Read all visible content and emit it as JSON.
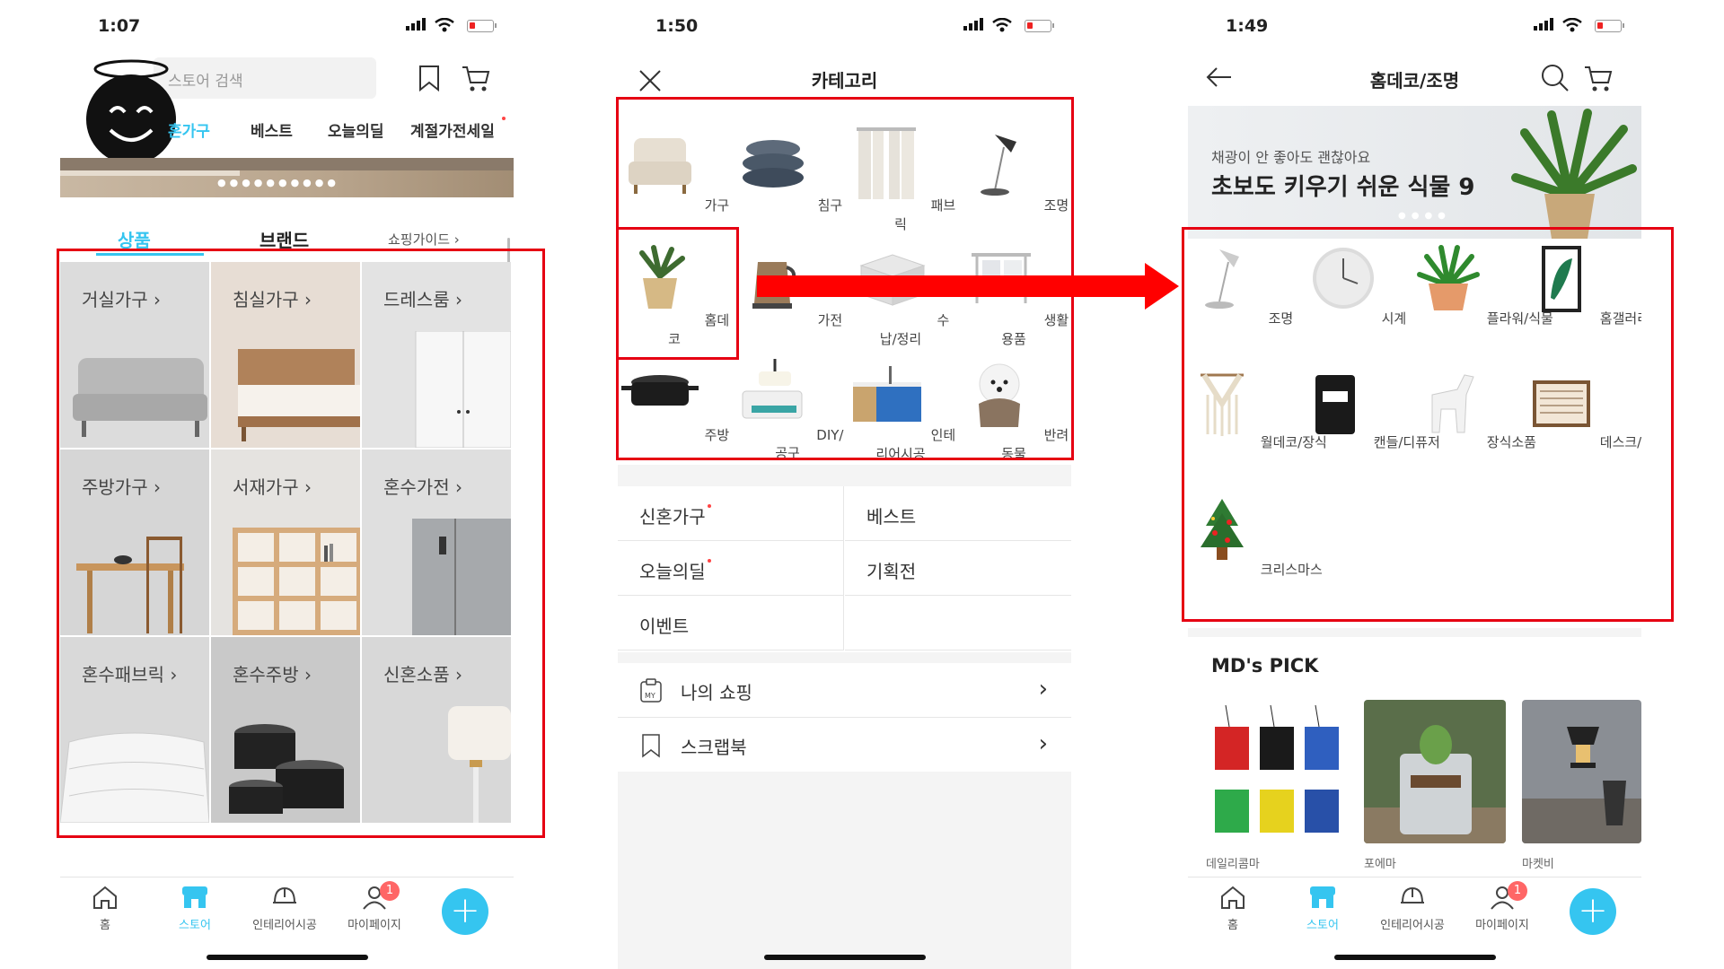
{
  "screen1": {
    "time": "1:07",
    "search_placeholder": "스토어 검색",
    "tabs": [
      "혼가구",
      "베스트",
      "오늘의딜",
      "계절가전세일"
    ],
    "segments": [
      "상품",
      "브랜드"
    ],
    "guide": "쇼핑가이드 ›",
    "categories": [
      "거실가구 ›",
      "침실가구 ›",
      "드레스룸 ›",
      "주방가구 ›",
      "서재가구 ›",
      "혼수가전 ›",
      "혼수패브릭 ›",
      "혼수주방 ›",
      "신혼소품 ›"
    ]
  },
  "screen2": {
    "time": "1:50",
    "title": "카테고리",
    "categories": [
      "가구",
      "침구",
      "패브릭",
      "조명",
      "홈데코",
      "가전",
      "수납/정리",
      "생활용품",
      "주방",
      "DIY/공구",
      "인테리어시공",
      "반려동물"
    ],
    "menu": [
      "신혼가구",
      "베스트",
      "오늘의딜",
      "기획전",
      "이벤트"
    ],
    "list": [
      "나의 쇼핑",
      "스크랩북"
    ],
    "my_icon_text": "MY"
  },
  "screen3": {
    "time": "1:49",
    "title": "홈데코/조명",
    "banner_sub": "채광이 안 좋아도 괜찮아요",
    "banner_main": "초보도 키우기 쉬운 식물 9",
    "categories": [
      "조명",
      "시계",
      "플라워/식물",
      "홈갤러리",
      "월데코/장식",
      "캔들/디퓨저",
      "장식소품",
      "데스크/디자인…",
      "크리스마스"
    ],
    "md_pick": "MD's PICK",
    "brands": [
      "데일리콤마",
      "포에마",
      "마켓비"
    ]
  },
  "bottom_nav": {
    "items": [
      "홈",
      "스토어",
      "인테리어시공",
      "마이페이지"
    ],
    "badge": "1",
    "fab": "+"
  },
  "colors": {
    "accent": "#35c5f0",
    "highlight": "#e60012",
    "badge": "#ff6666"
  }
}
